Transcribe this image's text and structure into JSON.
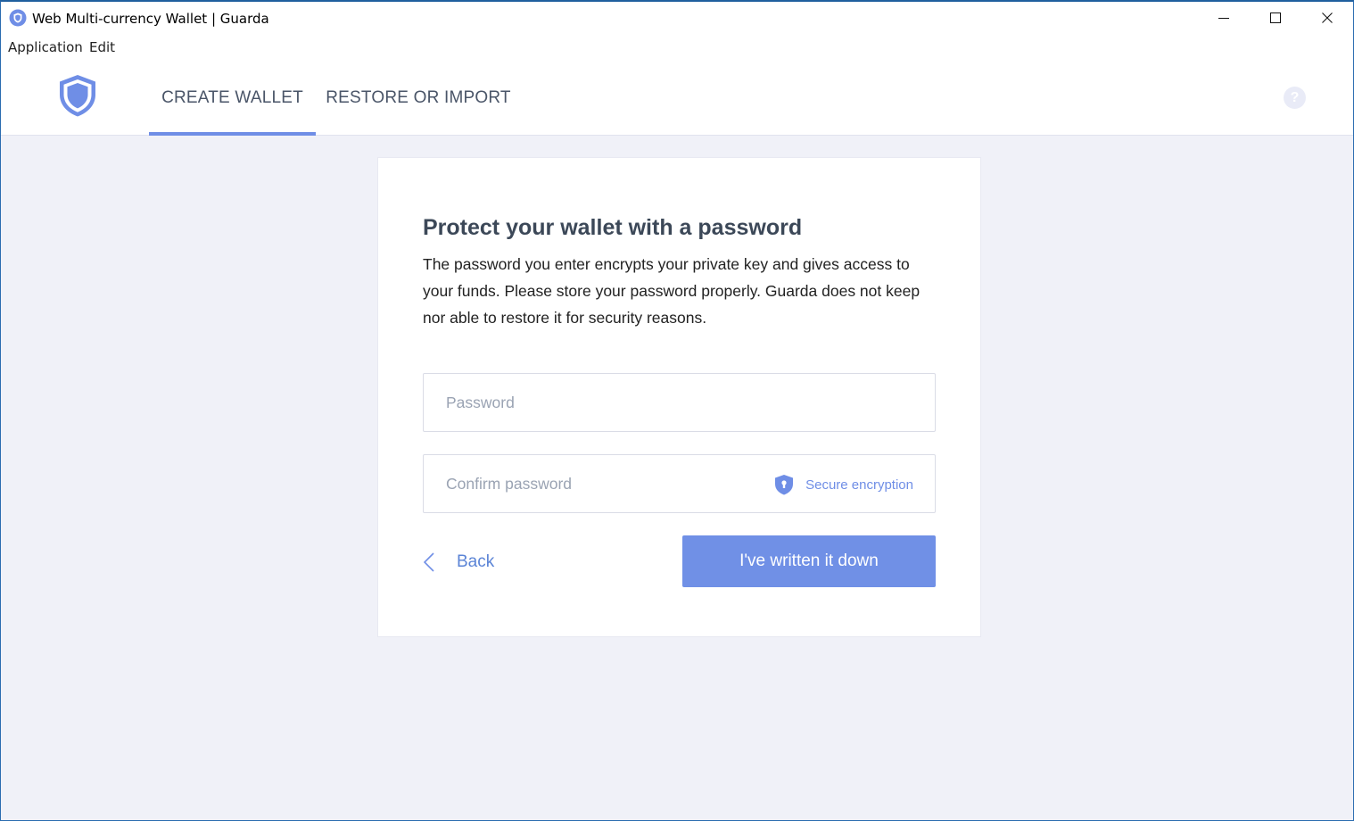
{
  "window": {
    "title": "Web Multi-currency Wallet | Guarda",
    "menu": [
      "Application",
      "Edit"
    ]
  },
  "nav": {
    "tabs": [
      {
        "label": "CREATE WALLET",
        "active": true
      },
      {
        "label": "RESTORE OR IMPORT",
        "active": false
      }
    ],
    "help_glyph": "?"
  },
  "card": {
    "title": "Protect your wallet with a password",
    "description": "The password you enter encrypts your private key and gives access to your funds. Please store your password properly. Guarda does not keep nor able to restore it for security reasons.",
    "password_placeholder": "Password",
    "confirm_placeholder": "Confirm password",
    "secure_label": "Secure encryption",
    "back_label": "Back",
    "submit_label": "I've written it down"
  },
  "icons": {
    "app": "guarda-shield-icon",
    "logo": "guarda-shield-logo",
    "secure": "shield-icon",
    "back": "chevron-left-icon",
    "help": "question-icon"
  },
  "colors": {
    "accent": "#6f8ee6",
    "button": "#7090e6",
    "background": "#f0f1f8",
    "title": "#3c4858"
  }
}
